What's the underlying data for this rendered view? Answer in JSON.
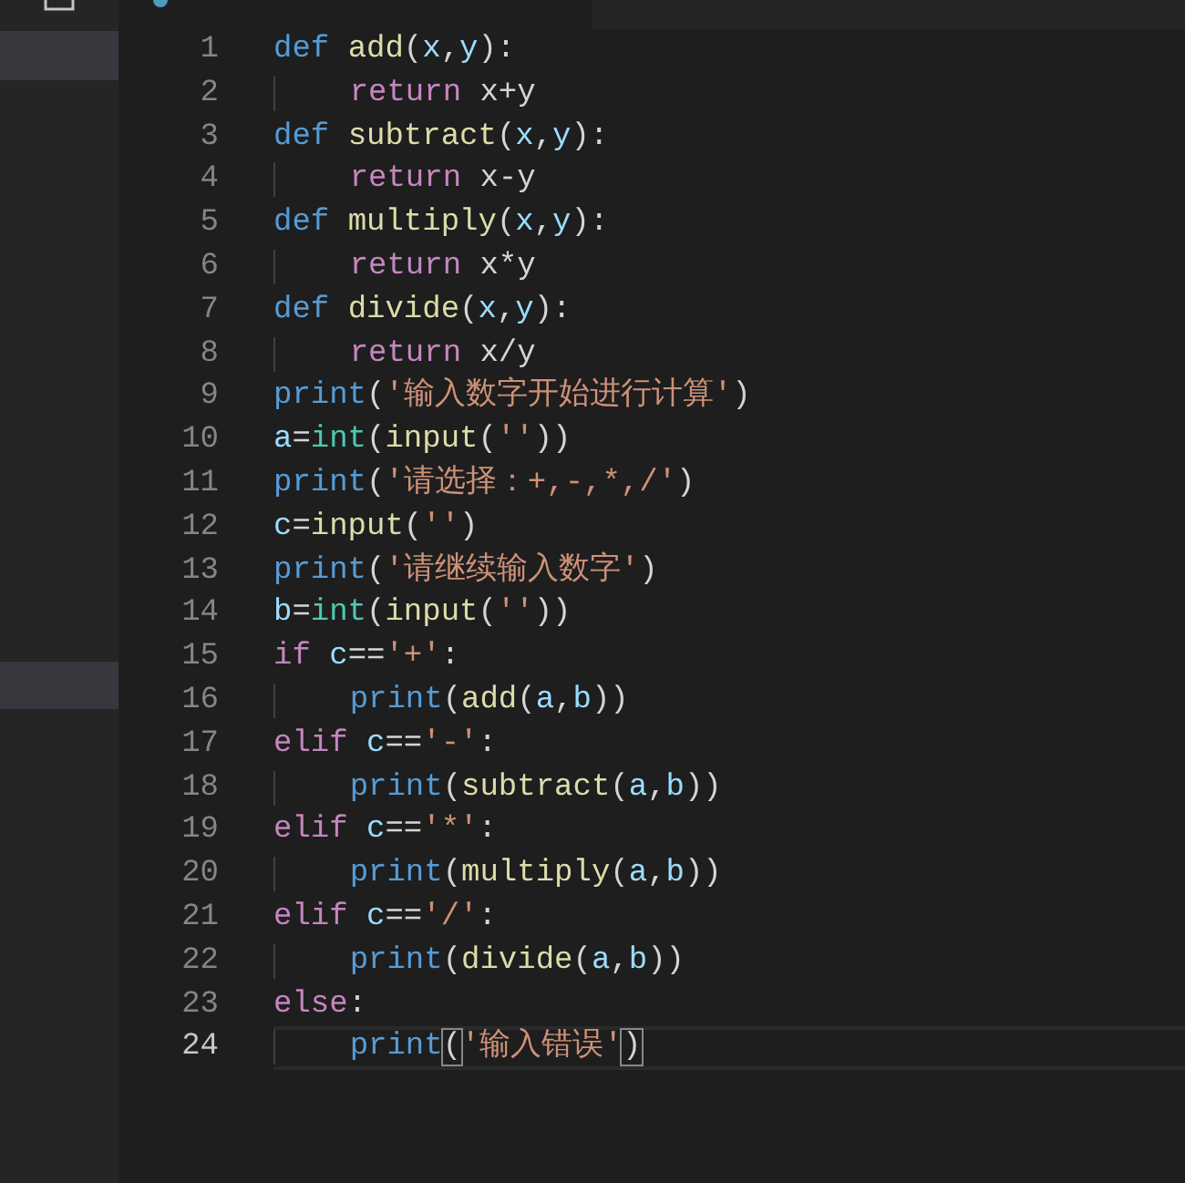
{
  "sidebar": {
    "rows": [
      {
        "selected": true
      },
      {
        "selected": true
      }
    ]
  },
  "editor": {
    "lines": [
      {
        "number": "1",
        "current": false,
        "indented": false,
        "tokens": [
          {
            "text": "def ",
            "kind": "keyword"
          },
          {
            "text": "add",
            "kind": "function"
          },
          {
            "text": "(",
            "kind": "plain"
          },
          {
            "text": "x",
            "kind": "variable"
          },
          {
            "text": ",",
            "kind": "plain"
          },
          {
            "text": "y",
            "kind": "variable"
          },
          {
            "text": "):",
            "kind": "plain"
          }
        ]
      },
      {
        "number": "2",
        "current": false,
        "indented": true,
        "tokens": [
          {
            "text": "return",
            "kind": "control"
          },
          {
            "text": " x+y",
            "kind": "plain"
          }
        ]
      },
      {
        "number": "3",
        "current": false,
        "indented": false,
        "tokens": [
          {
            "text": "def ",
            "kind": "keyword"
          },
          {
            "text": "subtract",
            "kind": "function"
          },
          {
            "text": "(",
            "kind": "plain"
          },
          {
            "text": "x",
            "kind": "variable"
          },
          {
            "text": ",",
            "kind": "plain"
          },
          {
            "text": "y",
            "kind": "variable"
          },
          {
            "text": "):",
            "kind": "plain"
          }
        ]
      },
      {
        "number": "4",
        "current": false,
        "indented": true,
        "tokens": [
          {
            "text": "return",
            "kind": "control"
          },
          {
            "text": " x-y",
            "kind": "plain"
          }
        ]
      },
      {
        "number": "5",
        "current": false,
        "indented": false,
        "tokens": [
          {
            "text": "def ",
            "kind": "keyword"
          },
          {
            "text": "multiply",
            "kind": "function"
          },
          {
            "text": "(",
            "kind": "plain"
          },
          {
            "text": "x",
            "kind": "variable"
          },
          {
            "text": ",",
            "kind": "plain"
          },
          {
            "text": "y",
            "kind": "variable"
          },
          {
            "text": "):",
            "kind": "plain"
          }
        ]
      },
      {
        "number": "6",
        "current": false,
        "indented": true,
        "tokens": [
          {
            "text": "return",
            "kind": "control"
          },
          {
            "text": " x*y",
            "kind": "plain"
          }
        ]
      },
      {
        "number": "7",
        "current": false,
        "indented": false,
        "tokens": [
          {
            "text": "def ",
            "kind": "keyword"
          },
          {
            "text": "divide",
            "kind": "function"
          },
          {
            "text": "(",
            "kind": "plain"
          },
          {
            "text": "x",
            "kind": "variable"
          },
          {
            "text": ",",
            "kind": "plain"
          },
          {
            "text": "y",
            "kind": "variable"
          },
          {
            "text": "):",
            "kind": "plain"
          }
        ]
      },
      {
        "number": "8",
        "current": false,
        "indented": true,
        "tokens": [
          {
            "text": "return",
            "kind": "control"
          },
          {
            "text": " x/y",
            "kind": "plain"
          }
        ]
      },
      {
        "number": "9",
        "current": false,
        "indented": false,
        "tokens": [
          {
            "text": "print",
            "kind": "keyword"
          },
          {
            "text": "(",
            "kind": "plain"
          },
          {
            "text": "'输入数字开始进行计算'",
            "kind": "string"
          },
          {
            "text": ")",
            "kind": "plain"
          }
        ]
      },
      {
        "number": "10",
        "current": false,
        "indented": false,
        "tokens": [
          {
            "text": "a",
            "kind": "variable"
          },
          {
            "text": "=",
            "kind": "plain"
          },
          {
            "text": "int",
            "kind": "type"
          },
          {
            "text": "(",
            "kind": "plain"
          },
          {
            "text": "input",
            "kind": "function"
          },
          {
            "text": "(",
            "kind": "plain"
          },
          {
            "text": "''",
            "kind": "string"
          },
          {
            "text": "))",
            "kind": "plain"
          }
        ]
      },
      {
        "number": "11",
        "current": false,
        "indented": false,
        "tokens": [
          {
            "text": "print",
            "kind": "keyword"
          },
          {
            "text": "(",
            "kind": "plain"
          },
          {
            "text": "'请选择：+,-,*,/'",
            "kind": "string"
          },
          {
            "text": ")",
            "kind": "plain"
          }
        ]
      },
      {
        "number": "12",
        "current": false,
        "indented": false,
        "tokens": [
          {
            "text": "c",
            "kind": "variable"
          },
          {
            "text": "=",
            "kind": "plain"
          },
          {
            "text": "input",
            "kind": "function"
          },
          {
            "text": "(",
            "kind": "plain"
          },
          {
            "text": "''",
            "kind": "string"
          },
          {
            "text": ")",
            "kind": "plain"
          }
        ]
      },
      {
        "number": "13",
        "current": false,
        "indented": false,
        "tokens": [
          {
            "text": "print",
            "kind": "keyword"
          },
          {
            "text": "(",
            "kind": "plain"
          },
          {
            "text": "'请继续输入数字'",
            "kind": "string"
          },
          {
            "text": ")",
            "kind": "plain"
          }
        ]
      },
      {
        "number": "14",
        "current": false,
        "indented": false,
        "tokens": [
          {
            "text": "b",
            "kind": "variable"
          },
          {
            "text": "=",
            "kind": "plain"
          },
          {
            "text": "int",
            "kind": "type"
          },
          {
            "text": "(",
            "kind": "plain"
          },
          {
            "text": "input",
            "kind": "function"
          },
          {
            "text": "(",
            "kind": "plain"
          },
          {
            "text": "''",
            "kind": "string"
          },
          {
            "text": "))",
            "kind": "plain"
          }
        ]
      },
      {
        "number": "15",
        "current": false,
        "indented": false,
        "tokens": [
          {
            "text": "if ",
            "kind": "control"
          },
          {
            "text": "c",
            "kind": "variable"
          },
          {
            "text": "==",
            "kind": "plain"
          },
          {
            "text": "'+'",
            "kind": "string"
          },
          {
            "text": ":",
            "kind": "plain"
          }
        ]
      },
      {
        "number": "16",
        "current": false,
        "indented": true,
        "tokens": [
          {
            "text": "print",
            "kind": "keyword"
          },
          {
            "text": "(",
            "kind": "plain"
          },
          {
            "text": "add",
            "kind": "function"
          },
          {
            "text": "(",
            "kind": "plain"
          },
          {
            "text": "a",
            "kind": "variable"
          },
          {
            "text": ",",
            "kind": "plain"
          },
          {
            "text": "b",
            "kind": "variable"
          },
          {
            "text": "))",
            "kind": "plain"
          }
        ]
      },
      {
        "number": "17",
        "current": false,
        "indented": false,
        "tokens": [
          {
            "text": "elif ",
            "kind": "control"
          },
          {
            "text": "c",
            "kind": "variable"
          },
          {
            "text": "==",
            "kind": "plain"
          },
          {
            "text": "'-'",
            "kind": "string"
          },
          {
            "text": ":",
            "kind": "plain"
          }
        ]
      },
      {
        "number": "18",
        "current": false,
        "indented": true,
        "tokens": [
          {
            "text": "print",
            "kind": "keyword"
          },
          {
            "text": "(",
            "kind": "plain"
          },
          {
            "text": "subtract",
            "kind": "function"
          },
          {
            "text": "(",
            "kind": "plain"
          },
          {
            "text": "a",
            "kind": "variable"
          },
          {
            "text": ",",
            "kind": "plain"
          },
          {
            "text": "b",
            "kind": "variable"
          },
          {
            "text": "))",
            "kind": "plain"
          }
        ]
      },
      {
        "number": "19",
        "current": false,
        "indented": false,
        "tokens": [
          {
            "text": "elif ",
            "kind": "control"
          },
          {
            "text": "c",
            "kind": "variable"
          },
          {
            "text": "==",
            "kind": "plain"
          },
          {
            "text": "'*'",
            "kind": "string"
          },
          {
            "text": ":",
            "kind": "plain"
          }
        ]
      },
      {
        "number": "20",
        "current": false,
        "indented": true,
        "tokens": [
          {
            "text": "print",
            "kind": "keyword"
          },
          {
            "text": "(",
            "kind": "plain"
          },
          {
            "text": "multiply",
            "kind": "function"
          },
          {
            "text": "(",
            "kind": "plain"
          },
          {
            "text": "a",
            "kind": "variable"
          },
          {
            "text": ",",
            "kind": "plain"
          },
          {
            "text": "b",
            "kind": "variable"
          },
          {
            "text": "))",
            "kind": "plain"
          }
        ]
      },
      {
        "number": "21",
        "current": false,
        "indented": false,
        "tokens": [
          {
            "text": "elif ",
            "kind": "control"
          },
          {
            "text": "c",
            "kind": "variable"
          },
          {
            "text": "==",
            "kind": "plain"
          },
          {
            "text": "'/'",
            "kind": "string"
          },
          {
            "text": ":",
            "kind": "plain"
          }
        ]
      },
      {
        "number": "22",
        "current": false,
        "indented": true,
        "tokens": [
          {
            "text": "print",
            "kind": "keyword"
          },
          {
            "text": "(",
            "kind": "plain"
          },
          {
            "text": "divide",
            "kind": "function"
          },
          {
            "text": "(",
            "kind": "plain"
          },
          {
            "text": "a",
            "kind": "variable"
          },
          {
            "text": ",",
            "kind": "plain"
          },
          {
            "text": "b",
            "kind": "variable"
          },
          {
            "text": "))",
            "kind": "plain"
          }
        ]
      },
      {
        "number": "23",
        "current": false,
        "indented": false,
        "tokens": [
          {
            "text": "else",
            "kind": "control"
          },
          {
            "text": ":",
            "kind": "plain"
          }
        ]
      },
      {
        "number": "24",
        "current": true,
        "indented": true,
        "tokens": [
          {
            "text": "print",
            "kind": "keyword"
          },
          {
            "text": "(",
            "kind": "bracket-match"
          },
          {
            "text": "'输入错误'",
            "kind": "string"
          },
          {
            "text": ")",
            "kind": "bracket-match"
          }
        ]
      }
    ]
  }
}
